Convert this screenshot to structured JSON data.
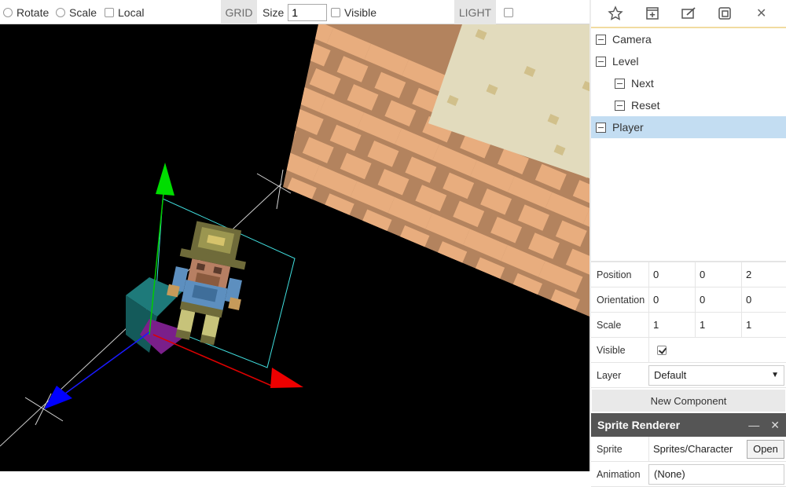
{
  "toolbar": {
    "rotate_label": "Rotate",
    "scale_label": "Scale",
    "local_label": "Local",
    "grid_label": "GRID",
    "size_label": "Size",
    "size_value": "1",
    "visible_label": "Visible",
    "light_label": "LIGHT"
  },
  "panel_toolbar": {
    "icons": [
      "star-icon",
      "add-icon",
      "edit-icon",
      "duplicate-icon",
      "close-icon"
    ],
    "close_glyph": "✕"
  },
  "tree": {
    "items": [
      {
        "label": "Camera",
        "depth": 0,
        "selected": false
      },
      {
        "label": "Level",
        "depth": 0,
        "selected": false
      },
      {
        "label": "Next",
        "depth": 1,
        "selected": false
      },
      {
        "label": "Reset",
        "depth": 1,
        "selected": false
      },
      {
        "label": "Player",
        "depth": 0,
        "selected": true
      }
    ]
  },
  "properties": {
    "position_label": "Position",
    "position": [
      "0",
      "0",
      "2"
    ],
    "orientation_label": "Orientation",
    "orientation": [
      "0",
      "0",
      "0"
    ],
    "scale_label": "Scale",
    "scale": [
      "1",
      "1",
      "1"
    ],
    "visible_label": "Visible",
    "visible_checked": true,
    "layer_label": "Layer",
    "layer_value": "Default",
    "dropdown_glyph": "▼",
    "new_component_label": "New Component"
  },
  "component": {
    "title": "Sprite Renderer",
    "minimize_glyph": "—",
    "close_glyph": "✕",
    "sprite_label": "Sprite",
    "sprite_value": "Sprites/Character",
    "open_label": "Open",
    "animation_label": "Animation",
    "animation_value": "(None)"
  },
  "colors": {
    "selected_row": "#c3ddf2",
    "header_bg": "#555555",
    "accent_border": "#f1dba0",
    "brick": "#e8ad7e",
    "mortar": "#b3835e",
    "sand": "#e2dbbd"
  }
}
